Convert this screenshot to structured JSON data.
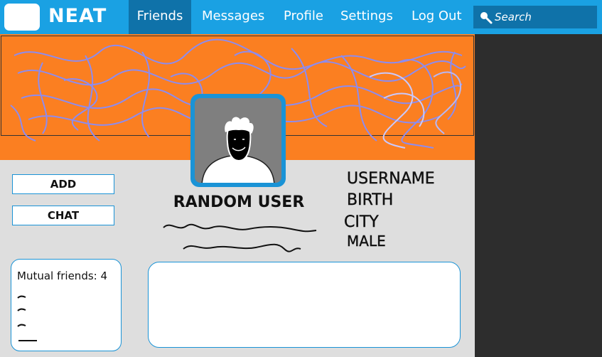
{
  "header": {
    "brand": "NEAT",
    "nav": [
      {
        "label": "Friends",
        "active": true
      },
      {
        "label": "Messages",
        "active": false
      },
      {
        "label": "Profile",
        "active": false
      },
      {
        "label": "Settings",
        "active": false
      },
      {
        "label": "Log Out",
        "active": false
      }
    ],
    "search_placeholder": "Search"
  },
  "profile": {
    "display_name": "RANDOM USER",
    "info_lines": [
      "USERNAME",
      "BIRTH",
      "CITY",
      "MALE"
    ]
  },
  "actions": {
    "add_label": "ADD",
    "chat_label": "CHAT"
  },
  "mutual": {
    "label": "Mutual friends:",
    "count": "4"
  },
  "colors": {
    "nav_blue": "#1aa1e3",
    "nav_active": "#0f72a9",
    "banner_orange": "#fb7f21",
    "scribble": "#8c8cf0",
    "panel_gray": "#dedede",
    "dark_panel": "#2d2d2d"
  },
  "icons": {
    "search": "search-icon"
  }
}
